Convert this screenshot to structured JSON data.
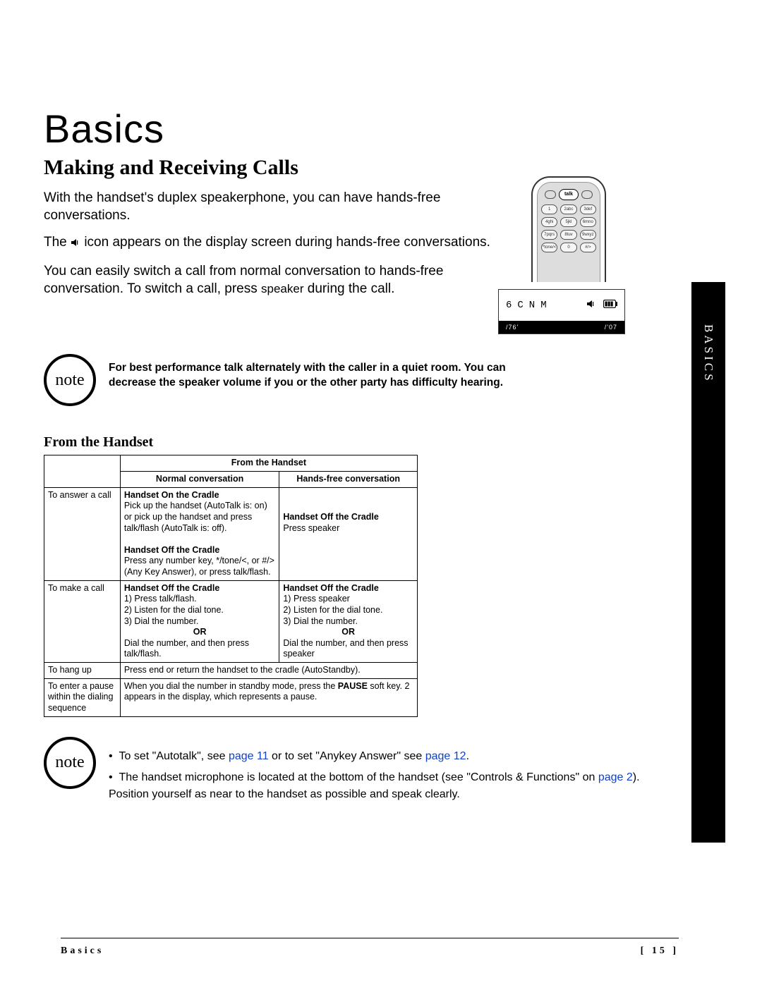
{
  "sideTab": "BASICS",
  "h1": "Basics",
  "h2": "Making and Receiving Calls",
  "para1": "With the handset's duplex speakerphone, you can have hands-free conversations.",
  "para2a": "The ",
  "para2b": " icon appears on the display screen during hands-free conversations.",
  "para3a": "You can easily switch a call from normal conversation to hands-free conversation. To switch a call, press ",
  "para3b": "speaker",
  "para3c": " during the call.",
  "phone": {
    "talk": "talk",
    "keys": [
      "1",
      "2abc",
      "3def",
      "4ghi",
      "5jkl",
      "6mno",
      "7pqrs",
      "8tuv",
      "9wxyz",
      "*tone/<",
      "0",
      "#/>"
    ]
  },
  "lcd": {
    "text": "6CNM",
    "left": "/76'",
    "right": "/'07"
  },
  "note1": {
    "label": "note",
    "text": "For best performance talk alternately with the caller in a quiet room. You can decrease the speaker volume if you or the other party has difficulty hearing."
  },
  "fromHandsetHeading": "From the Handset",
  "table": {
    "topHeader": "From the Handset",
    "col1": "Normal conversation",
    "col2": "Hands-free conversation",
    "rows": {
      "answer": {
        "label": "To answer a call",
        "normal_h1": "Handset On the Cradle",
        "normal_t1": "Pick up the handset (AutoTalk is: on) or pick up the handset and press talk/flash (AutoTalk is: off).",
        "normal_h2": "Handset Off the Cradle",
        "normal_t2": "Press any number key, */tone/<, or #/> (Any Key Answer), or press talk/flash.",
        "hands_h": "Handset Off the Cradle",
        "hands_t": "Press speaker"
      },
      "make": {
        "label": "To make a call",
        "normal_h": "Handset Off the Cradle",
        "normal_1": "1) Press talk/flash.",
        "normal_2": "2) Listen for the dial tone.",
        "normal_3": "3) Dial the number.",
        "or": "OR",
        "normal_alt": "Dial the number, and then press talk/flash.",
        "hands_h": "Handset Off the Cradle",
        "hands_1": "1) Press speaker",
        "hands_2": "2) Listen for the dial tone.",
        "hands_3": "3) Dial the number.",
        "hands_alt": "Dial the number, and then press speaker"
      },
      "hangup": {
        "label": "To hang up",
        "text": "Press end or return the handset to the cradle (AutoStandby)."
      },
      "pause": {
        "label": "To enter a pause within the dialing sequence",
        "text1": "When you dial the number in standby mode, press the ",
        "textB": "PAUSE",
        "text2": " soft key. 2 appears in the display, which represents a pause."
      }
    }
  },
  "note2": {
    "label": "note",
    "bullet1a": "To set \"Autotalk\", see ",
    "link1": "page 11",
    "bullet1b": " or to set \"Anykey Answer\" see ",
    "link2": "page 12",
    "bullet1c": ".",
    "bullet2a": "The handset microphone is located at the bottom of the handset (see \"Controls & Functions\" on ",
    "link3": "page 2",
    "bullet2b": "). Position yourself as near to the handset as possible and speak clearly."
  },
  "footer": {
    "left": "Basics",
    "right": "[ 15 ]"
  }
}
